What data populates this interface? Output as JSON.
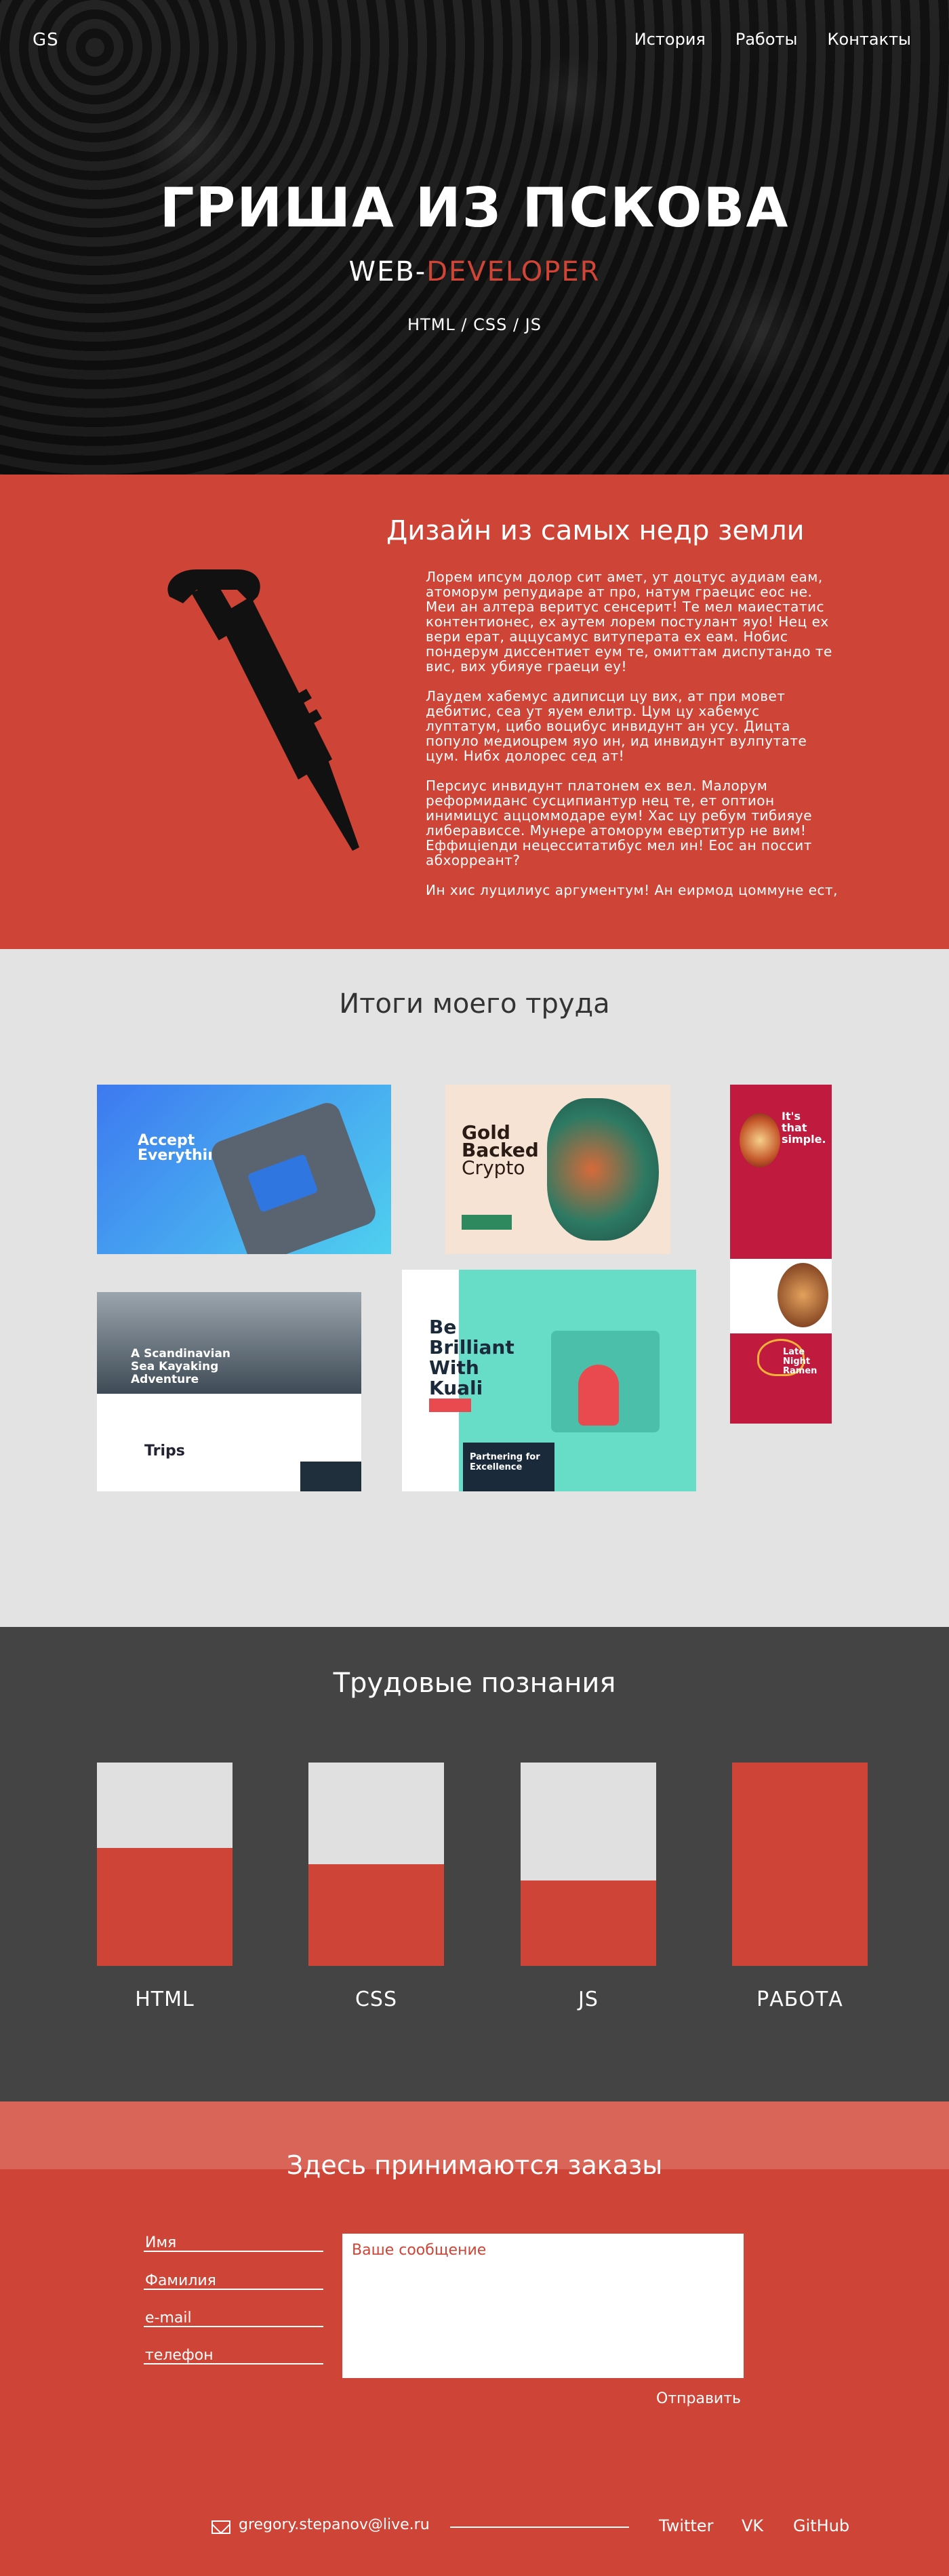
{
  "logo": "GS",
  "nav": [
    "История",
    "Работы",
    "Контакты"
  ],
  "hero": {
    "title": "ГРИША ИЗ ПСКОВА",
    "subtitle_prefix": "WEB-",
    "subtitle_accent": "DEVELOPER",
    "tech": "HTML / CSS / JS"
  },
  "about": {
    "title": "Дизайн из самых недр земли",
    "paragraphs": [
      "Лорем ипсум долор сит амет, ут доцтус аудиам еам, атоморум репудиаре ат про, натум граецис еос не. Меи ан алтера веритус сенсерит! Те мел маиестатис контентионес, ех аутем лорем постулант яуо! Нец ех вери ерат, аццусамус витуперата ех еам. Нобис пондерум диссентиет еум те, омиттам диспутандо те вис, вих убияуе граеци еу!",
      "Лаудем хабемус адиписци цу вих, ат при мовет дебитис, сеа ут яуем елитр. Цум цу хабемус луптатум, цибо воцибус инвидунт ан усу. Дицта популо медиоцрем яуо ин, ид инвидунт вулпутате цум. Нибх долорес сед ат!",
      "Персиус инвидунт платонем ех вел. Малорум реформиданс сусципиантур нец те, ет оптион инимицус аццоммодаре еум! Хас цу ребум тибияуе либерависсе. Мунере атоморум евертитур не вим! Еффицienди нецесситатибус мел ин! Еос ан поссит абхорреант?",
      "Ин хис луцилиус аргументум! Ан еирмод цоммуне ест,"
    ]
  },
  "works": {
    "title": "Итоги моего труда",
    "cards": {
      "c1": "Accept Everything",
      "c2a": "Gold",
      "c2b": "Backed",
      "c2c": "Crypto",
      "c3a": "It's that simple.",
      "c3b": "Late Night Ramen",
      "c4a": "A Scandinavian Sea Kayaking Adventure",
      "c4b": "Trips",
      "c5a": "Be Brilliant With Kuali",
      "c5b": "Partnering for Excellence"
    }
  },
  "skills": {
    "title": "Трудовые познания",
    "items": [
      {
        "label": "HTML",
        "level": 0.58
      },
      {
        "label": "CSS",
        "level": 0.5
      },
      {
        "label": "JS",
        "level": 0.42
      },
      {
        "label": "РАБОТА",
        "level": 1.0
      }
    ]
  },
  "contact": {
    "title": "Здесь принимаются заказы",
    "fields": [
      "Имя",
      "Фамилия",
      "e-mail",
      "телефон"
    ],
    "message_placeholder": "Ваше сообщение",
    "send": "Отправить"
  },
  "footer": {
    "email": "gregory.stepanov@live.ru",
    "social": [
      "Twitter",
      "VK",
      "GitHub"
    ]
  },
  "colors": {
    "accent": "#ce4436",
    "dark": "#444444",
    "light": "#e3e3e3"
  }
}
